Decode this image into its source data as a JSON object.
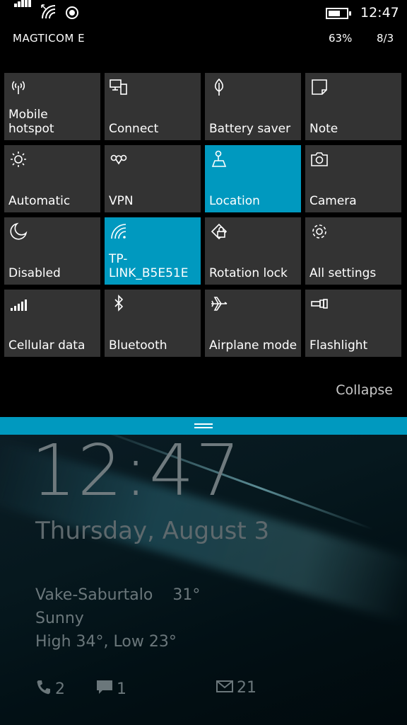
{
  "status": {
    "time": "12:47",
    "carrier": "MAGTICOM E",
    "battery_percent": "63%",
    "date": "8/3"
  },
  "tiles": [
    {
      "label": "Mobile\nhotspot",
      "icon": "hotspot-icon",
      "active": false
    },
    {
      "label": "Connect",
      "icon": "connect-icon",
      "active": false
    },
    {
      "label": "Battery saver",
      "icon": "battery-saver-icon",
      "active": false
    },
    {
      "label": "Note",
      "icon": "note-icon",
      "active": false
    },
    {
      "label": "Automatic",
      "icon": "brightness-icon",
      "active": false
    },
    {
      "label": "VPN",
      "icon": "vpn-icon",
      "active": false
    },
    {
      "label": "Location",
      "icon": "location-icon",
      "active": true
    },
    {
      "label": "Camera",
      "icon": "camera-icon",
      "active": false
    },
    {
      "label": "Disabled",
      "icon": "moon-icon",
      "active": false
    },
    {
      "label": "TP-\nLINK_B5E51E",
      "icon": "wifi-icon",
      "active": true
    },
    {
      "label": "Rotation lock",
      "icon": "rotation-lock-icon",
      "active": false
    },
    {
      "label": "All settings",
      "icon": "gear-icon",
      "active": false
    },
    {
      "label": "Cellular data",
      "icon": "cellular-icon",
      "active": false
    },
    {
      "label": "Bluetooth",
      "icon": "bluetooth-icon",
      "active": false
    },
    {
      "label": "Airplane mode",
      "icon": "airplane-icon",
      "active": false
    },
    {
      "label": "Flashlight",
      "icon": "flashlight-icon",
      "active": false
    }
  ],
  "collapse_label": "Collapse",
  "lockscreen": {
    "time": "12:47",
    "date": "Thursday, August 3",
    "location": "Vake-Saburtalo",
    "temperature": "31°",
    "condition": "Sunny",
    "high_low": "High 34°, Low 23°",
    "calls": "2",
    "messages": "1",
    "emails": "21"
  },
  "colors": {
    "accent": "#0099bf",
    "tile_off": "#333333",
    "background": "#000000"
  }
}
